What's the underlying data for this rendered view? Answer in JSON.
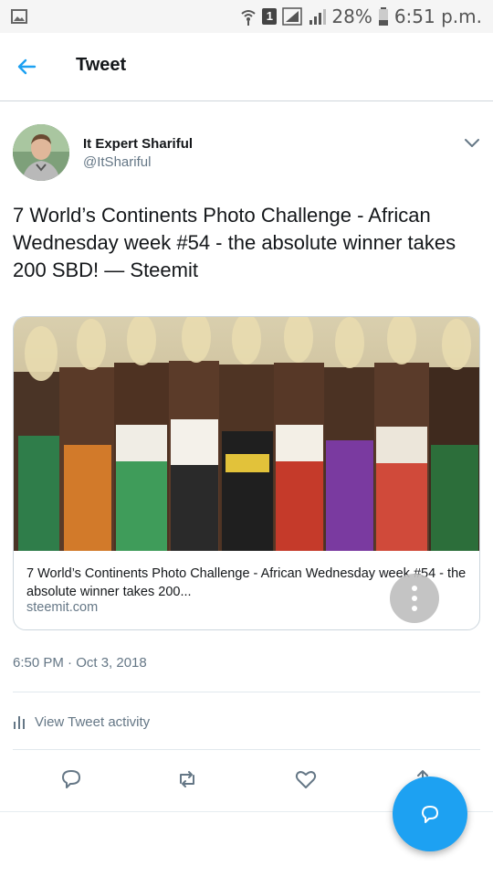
{
  "status_bar": {
    "battery": "28%",
    "time": "6:51 p.m.",
    "sim_slot": "1"
  },
  "header": {
    "title": "Tweet"
  },
  "tweet": {
    "author_name": "It Expert Shariful",
    "author_handle": "@ItShariful",
    "text": "7 World’s Continents Photo Challenge - African Wednesday week #54 - the absolute winner takes 200 SBD! — Steemit",
    "timestamp": "6:50 PM · Oct 3, 2018"
  },
  "card": {
    "title": "7 World’s Continents Photo Challenge - African Wednesday week #54 - the absolute winner takes 200...",
    "domain": "steemit.com"
  },
  "activity": {
    "label": "View Tweet activity"
  },
  "icons": {
    "back": "arrow-left-icon",
    "caret": "chevron-down-icon",
    "more": "more-vertical-icon",
    "activity": "bar-chart-icon",
    "reply": "reply-icon",
    "retweet": "retweet-icon",
    "like": "heart-icon",
    "share": "share-icon",
    "compose": "compose-icon"
  },
  "colors": {
    "accent": "#1da1f2",
    "secondary_text": "#657786",
    "border": "#ccd6dd"
  }
}
